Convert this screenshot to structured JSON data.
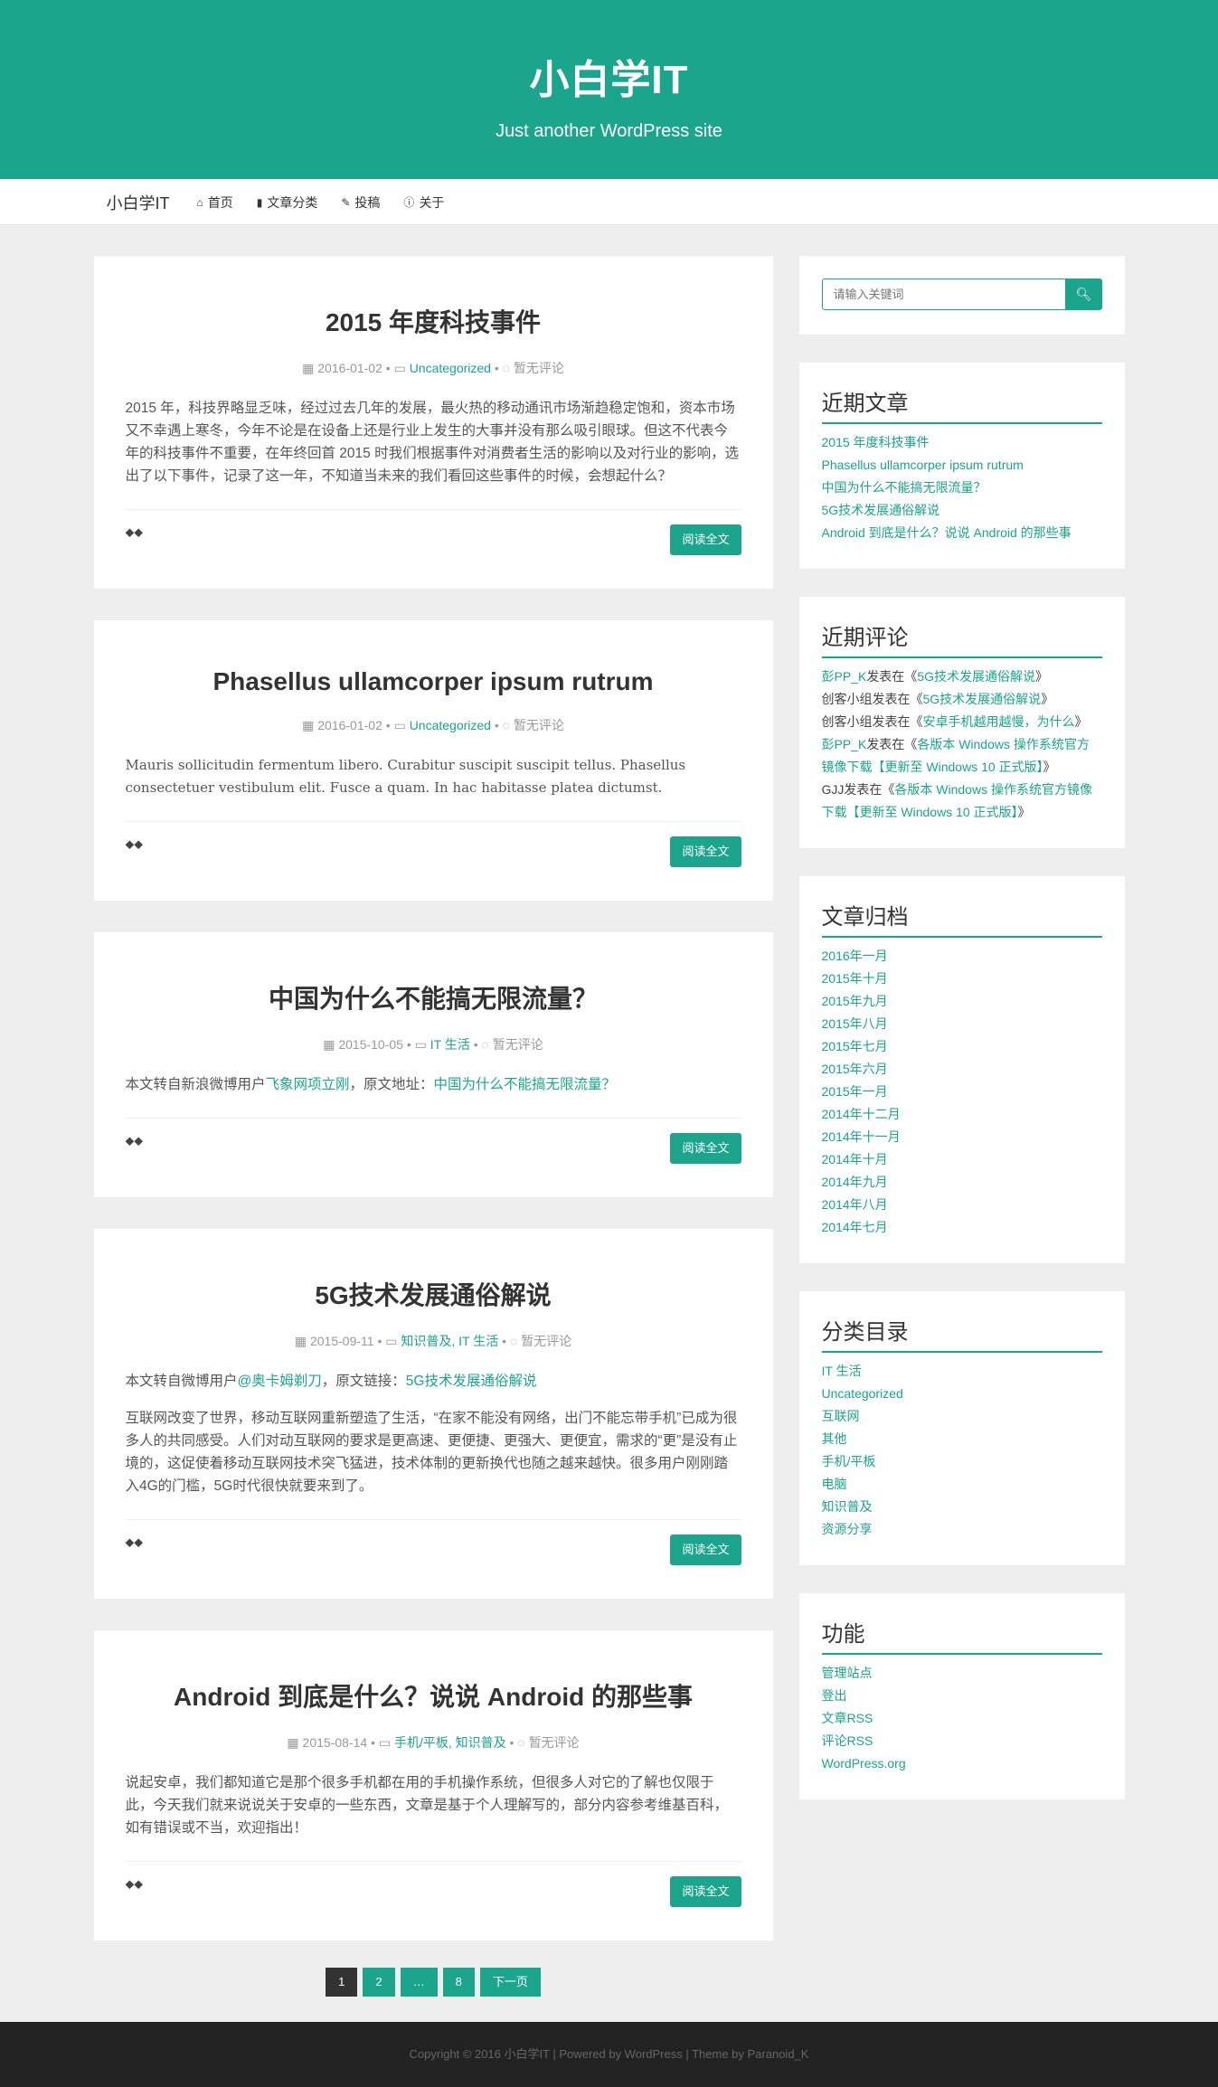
{
  "header": {
    "title": "小白学IT",
    "description": "Just another WordPress site"
  },
  "nav": {
    "brand": "小白学IT",
    "items": [
      {
        "label": "首页",
        "icon": "home-icon",
        "glyph": "⌂"
      },
      {
        "label": "文章分类",
        "icon": "book-icon",
        "glyph": "▮"
      },
      {
        "label": "投稿",
        "icon": "edit-icon",
        "glyph": "✎"
      },
      {
        "label": "关于",
        "icon": "info-icon",
        "glyph": "ⓘ"
      }
    ]
  },
  "posts": [
    {
      "title": "2015 年度科技事件",
      "date": "2016-01-02",
      "category": "Uncategorized",
      "comments": "暂无评论",
      "paragraphs": [
        "2015 年，科技界略显乏味，经过过去几年的发展，最火热的移动通讯市场渐趋稳定饱和，资本市场又不幸遇上寒冬，今年不论是在设备上还是行业上发生的大事并没有那么吸引眼球。但这不代表今年的科技事件不重要，在年终回首 2015 时我们根据事件对消费者生活的影响以及对行业的影响，选出了以下事件，记录了这一年，不知道当未来的我们看回这些事件的时候，会想起什么？"
      ],
      "read_more": "阅读全文"
    },
    {
      "title": "Phasellus ullamcorper ipsum rutrum",
      "date": "2016-01-02",
      "category": "Uncategorized",
      "comments": "暂无评论",
      "paragraphs": [
        "Mauris sollicitudin fermentum libero. Curabitur suscipit suscipit tellus. Phasellus consectetuer vestibulum elit. Fusce a quam. In hac habitasse platea dictumst."
      ],
      "read_more": "阅读全文"
    },
    {
      "title": "中国为什么不能搞无限流量？",
      "date": "2015-10-05",
      "category": "IT 生活",
      "comments": "暂无评论",
      "intro_prefix": "本文转自新浪微博用户",
      "intro_link1": "飞象网项立刚",
      "intro_mid": "，原文地址：",
      "intro_link2": "中国为什么不能搞无限流量？",
      "read_more": "阅读全文"
    },
    {
      "title": "5G技术发展通俗解说",
      "date": "2015-09-11",
      "category": "知识普及, IT 生活",
      "comments": "暂无评论",
      "intro_prefix": "本文转自微博用户",
      "intro_link1": "@奥卡姆剃刀",
      "intro_mid": "，原文链接：",
      "intro_link2": "5G技术发展通俗解说",
      "paragraphs": [
        "互联网改变了世界，移动互联网重新塑造了生活，“在家不能没有网络，出门不能忘带手机”已成为很多人的共同感受。人们对动互联网的要求是更高速、更便捷、更强大、更便宜，需求的“更”是没有止境的，这促使着移动互联网技术突飞猛进，技术体制的更新换代也随之越来越快。很多用户刚刚踏入4G的门槛，5G时代很快就要来到了。"
      ],
      "read_more": "阅读全文"
    },
    {
      "title": "Android 到底是什么？说说 Android 的那些事",
      "date": "2015-08-14",
      "category": "手机/平板, 知识普及",
      "comments": "暂无评论",
      "paragraphs": [
        "说起安卓，我们都知道它是那个很多手机都在用的手机操作系统，但很多人对它的了解也仅限于此，今天我们就来说说关于安卓的一些东西，文章是基于个人理解写的，部分内容参考维基百科，如有错误或不当，欢迎指出！"
      ],
      "read_more": "阅读全文"
    }
  ],
  "pagination": {
    "pages": [
      "1",
      "2",
      "…",
      "8"
    ],
    "next": "下一页"
  },
  "sidebar": {
    "search_placeholder": "请输入关键词",
    "recent_posts": {
      "title": "近期文章",
      "items": [
        "2015 年度科技事件",
        "Phasellus ullamcorper ipsum rutrum",
        "中国为什么不能搞无限流量？",
        "5G技术发展通俗解说",
        "Android 到底是什么？说说 Android 的那些事"
      ]
    },
    "recent_comments": {
      "title": "近期评论",
      "items": [
        {
          "author": "彭PP_K",
          "author_link": true,
          "on": "发表在《",
          "post": "5G技术发展通俗解说",
          "end": "》"
        },
        {
          "author": "创客小组",
          "author_link": false,
          "on": "发表在《",
          "post": "5G技术发展通俗解说",
          "end": "》"
        },
        {
          "author": "创客小组",
          "author_link": false,
          "on": "发表在《",
          "post": "安卓手机越用越慢，为什么",
          "end": "》"
        },
        {
          "author": "彭PP_K",
          "author_link": true,
          "on": "发表在《",
          "post": "各版本 Windows 操作系统官方镜像下载【更新至 Windows 10 正式版】",
          "end": "》"
        },
        {
          "author": "GJJ",
          "author_link": false,
          "on": "发表在《",
          "post": "各版本 Windows 操作系统官方镜像下载【更新至 Windows 10 正式版】",
          "end": "》"
        }
      ]
    },
    "archives": {
      "title": "文章归档",
      "items": [
        "2016年一月",
        "2015年十月",
        "2015年九月",
        "2015年八月",
        "2015年七月",
        "2015年六月",
        "2015年一月",
        "2014年十二月",
        "2014年十一月",
        "2014年十月",
        "2014年九月",
        "2014年八月",
        "2014年七月"
      ]
    },
    "categories": {
      "title": "分类目录",
      "items": [
        "IT 生活",
        "Uncategorized",
        "互联网",
        "其他",
        "手机/平板",
        "电脑",
        "知识普及",
        "资源分享"
      ]
    },
    "meta": {
      "title": "功能",
      "items": [
        "管理站点",
        "登出",
        "文章RSS",
        "评论RSS",
        "WordPress.org"
      ]
    }
  },
  "footer": {
    "text": "Copyright © 2016 小白学IT | Powered by WordPress | Theme by Paranoid_K"
  },
  "colors": {
    "accent": "#1aa58c",
    "background": "#eeeeee",
    "footer": "#222222"
  }
}
